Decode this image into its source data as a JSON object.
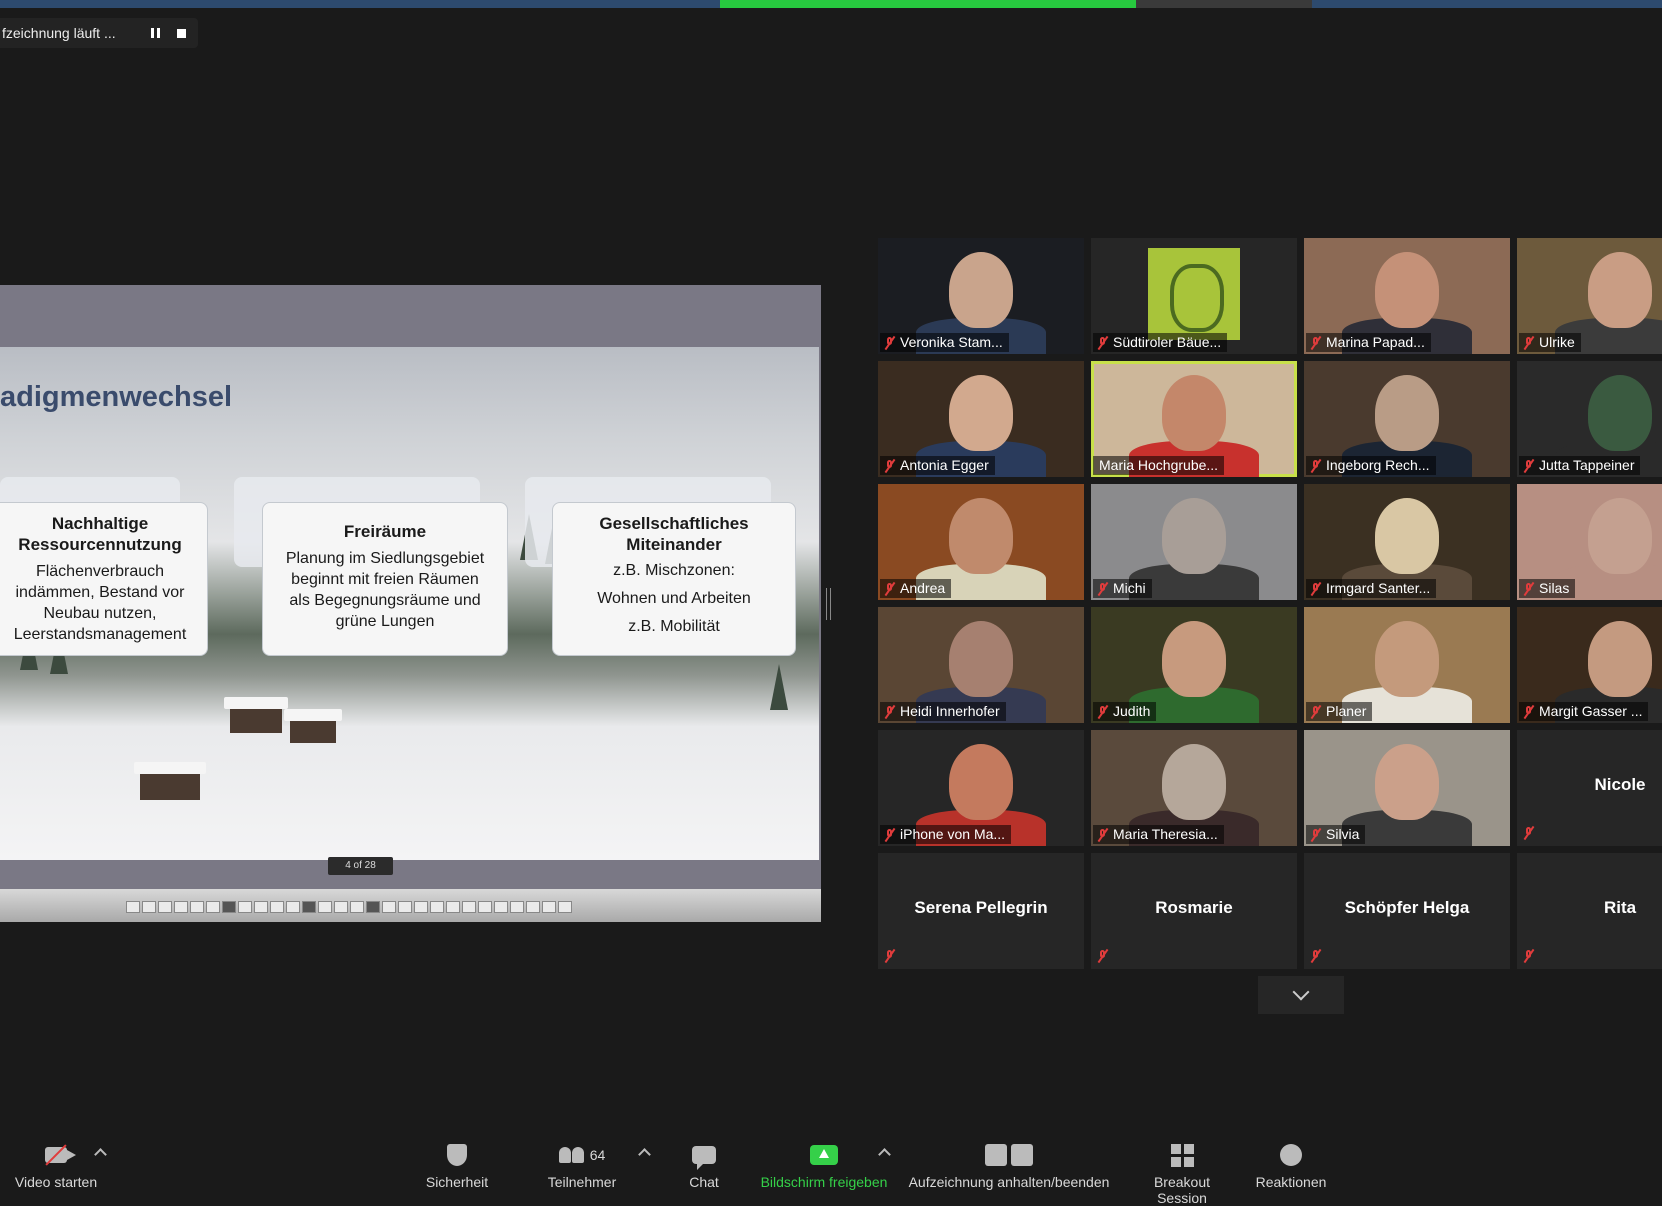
{
  "recording": {
    "label": "fzeichnung läuft ..."
  },
  "slide": {
    "title": "adigmenwechsel",
    "cards": [
      {
        "title_lines": [
          "Nachhaltige",
          "Ressourcennutzung"
        ],
        "body_lines": [
          "Flächenverbrauch",
          "indämmen, Bestand vor",
          "Neubau nutzen,",
          "Leerstandsmanagement"
        ]
      },
      {
        "title_lines": [
          "Freiräume"
        ],
        "body_lines": [
          "Planung im Siedlungsgebiet",
          "beginnt mit freien Räumen",
          "als Begegnungsräume und",
          "grüne Lungen"
        ]
      },
      {
        "title_lines": [
          "Gesellschaftliches",
          "Miteinander"
        ],
        "body_lines": [
          "z.B. Mischzonen:",
          "Wohnen und Arbeiten",
          "z.B. Mobilität"
        ]
      }
    ],
    "page_indicator": "4 of 28"
  },
  "participants": [
    {
      "name": "Veronika Stam...",
      "muted": true,
      "video": true,
      "face": "#c9a48c",
      "bg": "#1b1d22",
      "body": "#2b3a55"
    },
    {
      "name": "Südtiroler Bäue...",
      "muted": true,
      "video": "logo"
    },
    {
      "name": "Marina Papad...",
      "muted": true,
      "video": true,
      "face": "#c59178",
      "bg": "#8c6a55",
      "body": "#2f2f38"
    },
    {
      "name": "Ulrike",
      "muted": true,
      "video": true,
      "face": "#c99d84",
      "bg": "#6d5a3c",
      "body": "#3b3b3b"
    },
    {
      "name": "Antonia Egger",
      "muted": true,
      "video": true,
      "face": "#d2a98e",
      "bg": "#3a2c20",
      "body": "#2a3b5c"
    },
    {
      "name": "Maria Hochgrube...",
      "muted": false,
      "video": true,
      "speaker": true,
      "face": "#c4876a",
      "bg": "#cdb79a",
      "body": "#c8312d"
    },
    {
      "name": "Ingeborg Rech...",
      "muted": true,
      "video": true,
      "face": "#b99c86",
      "bg": "#4a3a2e",
      "body": "#1c2533"
    },
    {
      "name": "Jutta Tappeiner",
      "muted": true,
      "video": true,
      "face": "#3a5a40",
      "bg": "#2a2a2a",
      "body": "#2a2a2a"
    },
    {
      "name": "Andrea",
      "muted": true,
      "video": true,
      "face": "#c08a6c",
      "bg": "#8a4a22",
      "body": "#d8d3b8"
    },
    {
      "name": "Michi",
      "muted": true,
      "video": true,
      "face": "#a89e97",
      "bg": "#8b8b8d",
      "body": "#3a3a3a"
    },
    {
      "name": "Irmgard Santer...",
      "muted": true,
      "video": true,
      "face": "#d9c7a4",
      "bg": "#3b3022",
      "body": "#5a4a3a"
    },
    {
      "name": "Silas",
      "muted": true,
      "video": true,
      "face": "#c4a090",
      "bg": "#b78f82",
      "body": "#b78f82"
    },
    {
      "name": "Heidi Innerhofer",
      "muted": true,
      "video": true,
      "face": "#a68070",
      "bg": "#5a4634",
      "body": "#353a52"
    },
    {
      "name": "Judith",
      "muted": true,
      "video": true,
      "face": "#c79a7e",
      "bg": "#3a3a22",
      "body": "#2e6a2e"
    },
    {
      "name": "Planer",
      "muted": true,
      "video": true,
      "face": "#c49a7c",
      "bg": "#9a7a52",
      "body": "#e6e2d8"
    },
    {
      "name": "Margit Gasser ...",
      "muted": true,
      "video": true,
      "face": "#c49a80",
      "bg": "#3a2a1c",
      "body": "#2a2a2a"
    },
    {
      "name": "iPhone von Ma...",
      "muted": true,
      "video": true,
      "face": "#c47a5e",
      "bg": "#262626",
      "body": "#b8322a"
    },
    {
      "name": "Maria Theresia...",
      "muted": true,
      "video": true,
      "face": "#b5a79a",
      "bg": "#5a4a3c",
      "body": "#3a2a2a"
    },
    {
      "name": "Silvia",
      "muted": true,
      "video": true,
      "face": "#cba08a",
      "bg": "#9a948a",
      "body": "#3a3a3a"
    },
    {
      "name": "Nicole",
      "muted": true,
      "video": false
    },
    {
      "name": "Serena Pellegrin",
      "muted": true,
      "video": false
    },
    {
      "name": "Rosmarie",
      "muted": true,
      "video": false
    },
    {
      "name": "Schöpfer Helga",
      "muted": true,
      "video": false
    },
    {
      "name": "Rita",
      "muted": true,
      "video": false
    }
  ],
  "toolbar": {
    "video": "Video starten",
    "security": "Sicherheit",
    "participants": "Teilnehmer",
    "participant_count": "64",
    "chat": "Chat",
    "share": "Bildschirm freigeben",
    "recording": "Aufzeichnung anhalten/beenden",
    "breakout": "Breakout Session",
    "reactions": "Reaktionen"
  }
}
